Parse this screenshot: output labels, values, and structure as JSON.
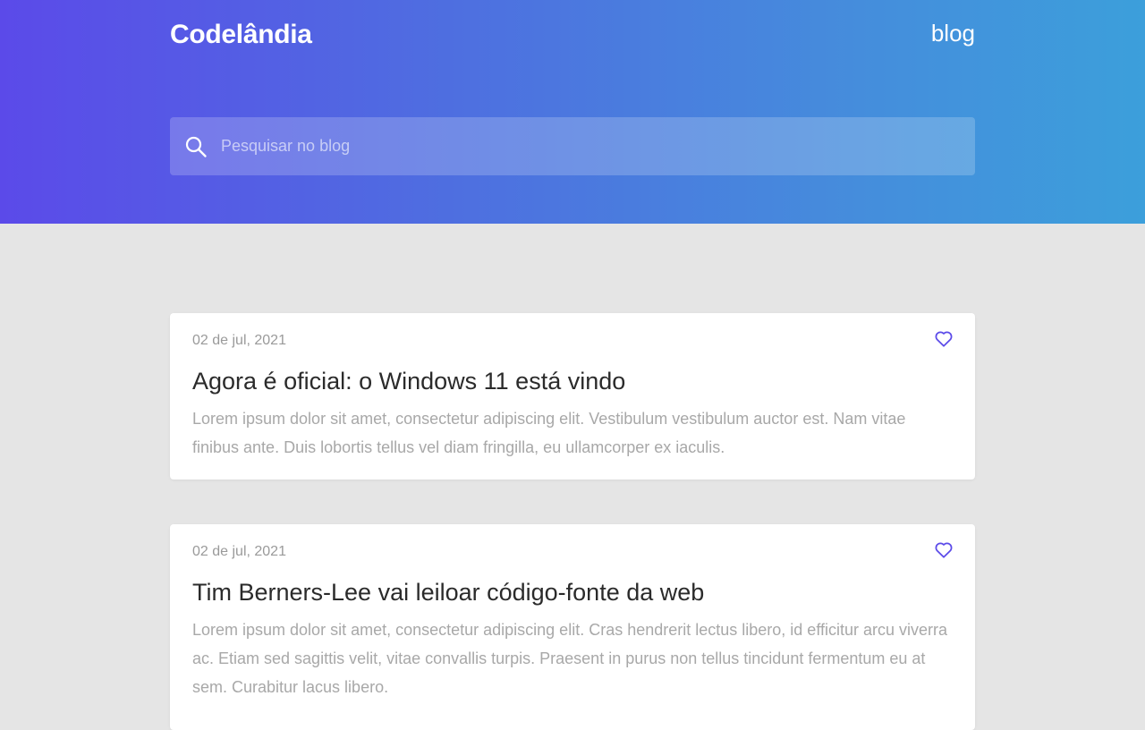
{
  "header": {
    "logo": "Codelândia",
    "nav_blog": "blog",
    "search": {
      "placeholder": "Pesquisar no blog",
      "icon": "search-icon"
    }
  },
  "posts": [
    {
      "date": "02 de jul, 2021",
      "title": "Agora é oficial: o Windows 11 está vindo",
      "excerpt": "Lorem ipsum dolor sit amet, consectetur adipiscing elit. Vestibulum vestibulum auctor est. Nam vitae finibus ante. Duis lobortis tellus vel diam fringilla, eu ullamcorper ex iaculis.",
      "like_icon": "heart-icon"
    },
    {
      "date": "02 de jul, 2021",
      "title": "Tim Berners-Lee vai leiloar código-fonte da web",
      "excerpt": "Lorem ipsum dolor sit amet, consectetur adipiscing elit. Cras hendrerit lectus libero, id efficitur arcu viverra ac. Etiam sed sagittis velit, vitae convallis turpis. Praesent in purus non tellus tincidunt fermentum eu at sem. Curabitur lacus libero.",
      "like_icon": "heart-icon"
    }
  ],
  "colors": {
    "gradient_start": "#5b4ae9",
    "gradient_end": "#3c9fdb",
    "accent": "#5b4ae9",
    "page_background": "#e5e5e5"
  }
}
